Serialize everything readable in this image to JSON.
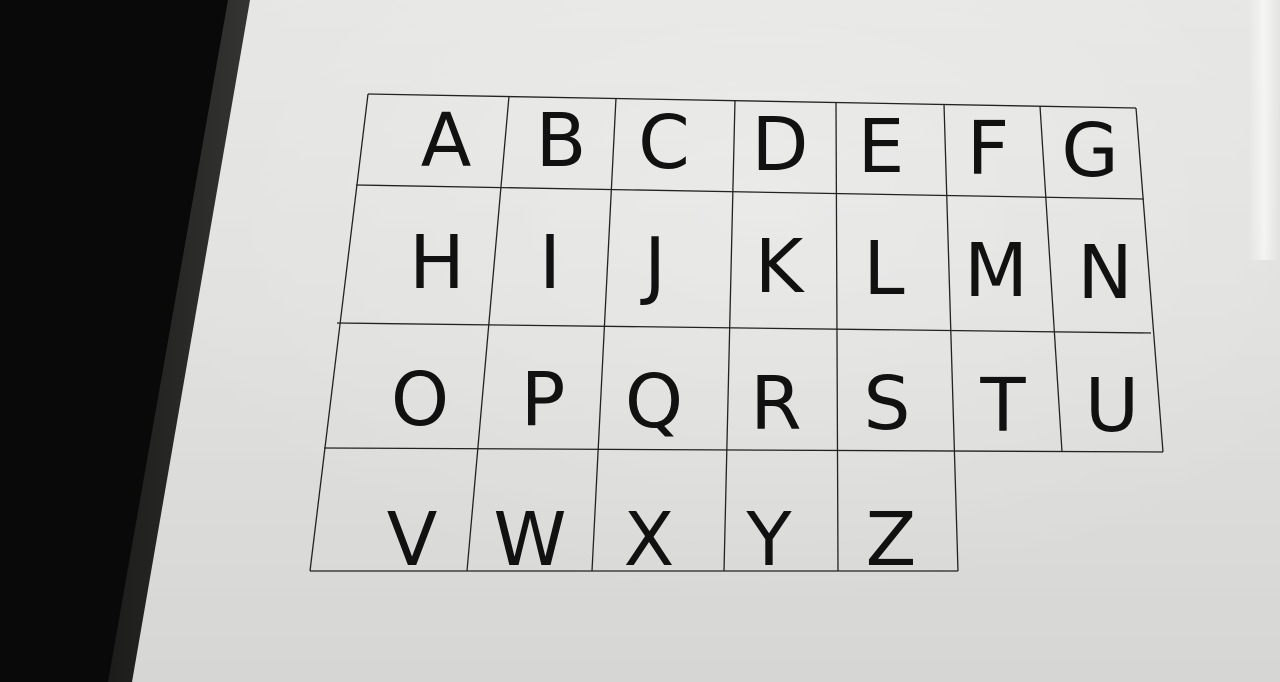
{
  "photo": {
    "subject": "alphabet-grid-sheet",
    "letters": [
      [
        "A",
        "B",
        "C",
        "D",
        "E",
        "F",
        "G"
      ],
      [
        "H",
        "I",
        "J",
        "K",
        "L",
        "M",
        "N"
      ],
      [
        "O",
        "P",
        "Q",
        "R",
        "S",
        "T",
        "U"
      ],
      [
        "V",
        "W",
        "X",
        "Y",
        "Z"
      ]
    ]
  },
  "colors": {
    "paper": "#e3e3e1",
    "ink": "#111111",
    "background": "#090909"
  }
}
